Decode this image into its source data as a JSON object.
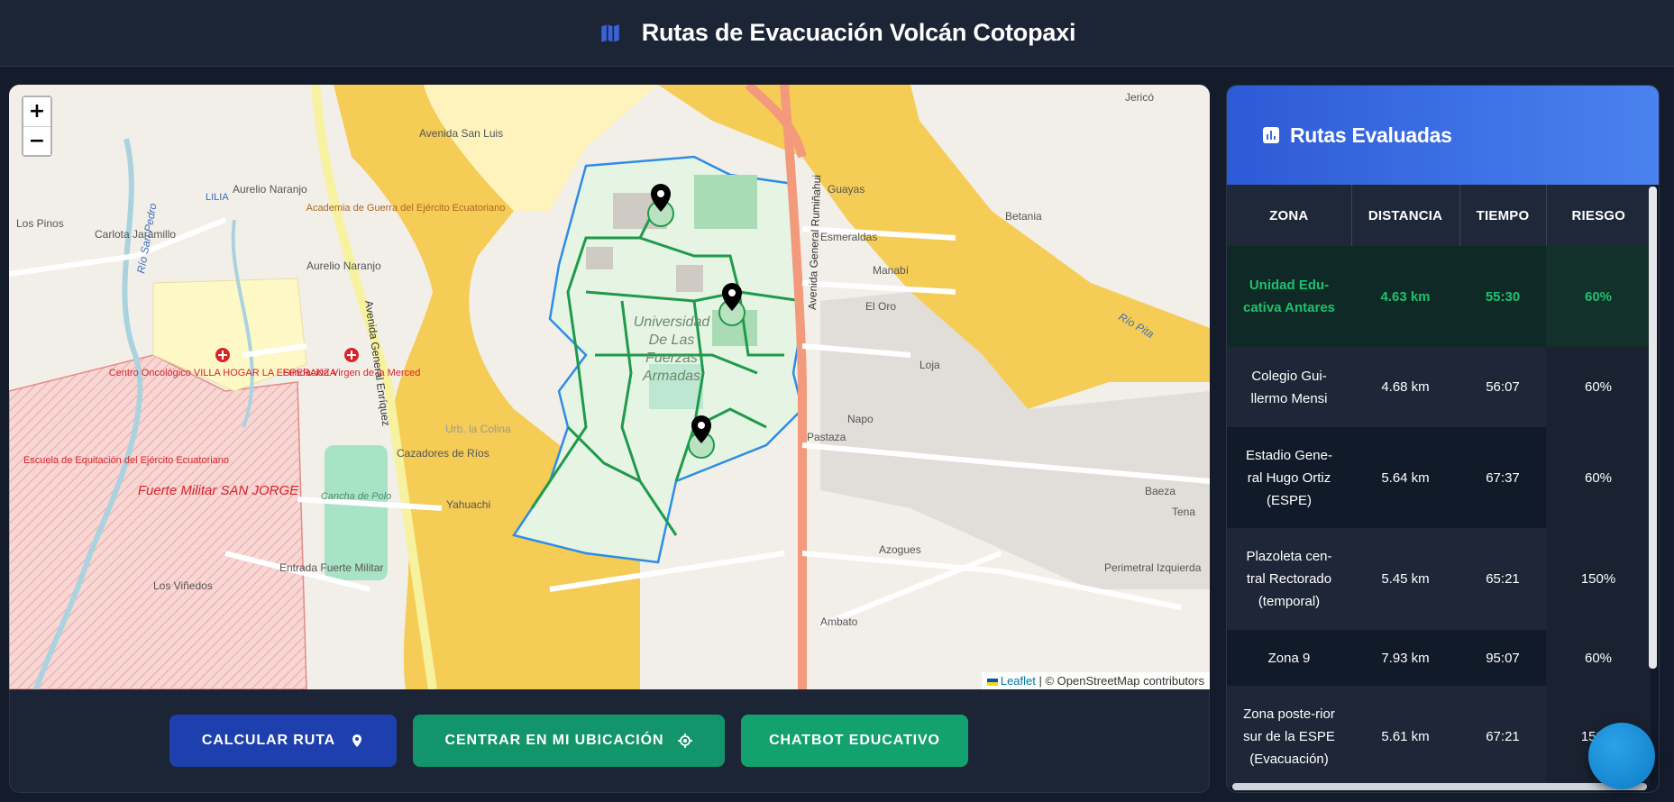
{
  "header": {
    "title": "Rutas de Evacuación Volcán Cotopaxi",
    "icon": "map-icon"
  },
  "map": {
    "zoom_in_label": "+",
    "zoom_out_label": "−",
    "attribution_leaflet": "Leaflet",
    "attribution_rest": " | © OpenStreetMap contributors",
    "labels": {
      "lilia": "LILIA",
      "los_pinos": "Los Pinos",
      "aurelio_naranjo": "Aurelio Naranjo",
      "aurelio_naranjo2": "Aurelio Naranjo",
      "avenida_san_luis": "Avenida San Luis",
      "academia": "Academia de Guerra del Ejército Ecuatoriano",
      "centro_oncologico": "Centro Oncológico VILLA HOGAR LA ESPERANZA",
      "fundacion": "Fundación Virgen de la Merced",
      "escuela": "Escuela de Equitación del Ejército Ecuatoriano",
      "fuerte": "Fuerte Militar SAN JORGE",
      "cancha": "Cancha de Polo",
      "universidad": "Universidad De Las Fuerzas Armadas",
      "la_colina": "Urb. la Colina",
      "av_general_enriquez": "Avenida General Enríquez",
      "av_general_ruminahui": "Avenida General Rumiñahui",
      "rio_san_pedro": "Río San Pedro",
      "rio_pita": "Río Pita",
      "guayas": "Guayas",
      "esmeraldas": "Esmeraldas",
      "manabi": "Manabí",
      "el_oro": "El Oro",
      "napo": "Napo",
      "pastaza": "Pastaza",
      "azogues": "Azogues",
      "ambato": "Ambato",
      "los_vinedos": "Los Viñedos",
      "entrada_fuerte": "Entrada Fuerte Militar",
      "yahuachi": "Yahuachi",
      "cazadores": "Cazadores de Ríos",
      "perimetral": "Perimetral Izquierda",
      "baeza": "Baeza",
      "tena": "Tena",
      "loja": "Loja",
      "jerico": "Jericó",
      "betania": "Betania",
      "carlota": "Carlota Jaramillo"
    }
  },
  "controls": {
    "calcular": "CALCULAR RUTA",
    "centrar": "CENTRAR EN MI UBICACIÓN",
    "chatbot": "CHATBOT EDUCATIVO"
  },
  "panel": {
    "title": "Rutas Evaluadas",
    "columns": [
      "ZONA",
      "DISTANCIA",
      "TIEMPO",
      "RIESGO"
    ],
    "rows": [
      {
        "zona": "Unidad Edu-cativa Antares",
        "distancia": "4.63 km",
        "tiempo": "55:30",
        "riesgo": "60%"
      },
      {
        "zona": "Colegio Gui-llermo Mensi",
        "distancia": "4.68 km",
        "tiempo": "56:07",
        "riesgo": "60%"
      },
      {
        "zona": "Estadio Gene-ral Hugo Ortiz (ESPE)",
        "distancia": "5.64 km",
        "tiempo": "67:37",
        "riesgo": "60%"
      },
      {
        "zona": "Plazoleta cen-tral Rectorado (temporal)",
        "distancia": "5.45 km",
        "tiempo": "65:21",
        "riesgo": "150%"
      },
      {
        "zona": "Zona 9",
        "distancia": "7.93 km",
        "tiempo": "95:07",
        "riesgo": "60%"
      },
      {
        "zona": "Zona poste-rior sur de la ESPE (Evacuación)",
        "distancia": "5.61 km",
        "tiempo": "67:21",
        "riesgo": "150%"
      }
    ]
  },
  "colors": {
    "accent_blue": "#1e3fae",
    "accent_green": "#12956a",
    "hazard_zone": "#f7c33b",
    "route_line": "#1f9a4a",
    "campus_border": "#2f8ce6"
  }
}
